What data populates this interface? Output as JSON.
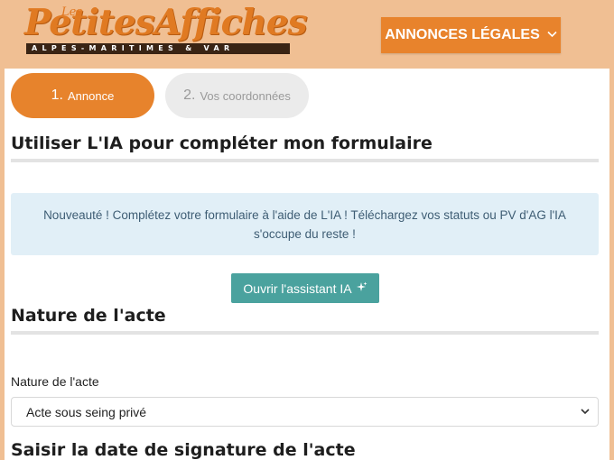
{
  "header": {
    "logo": {
      "les": "Les",
      "brand": "PetitesAffiches",
      "region": "ALPES-MARITIMES & VAR"
    },
    "menu_button": {
      "label": "ANNONCES LÉGALES",
      "icon": "chevron-down-icon"
    }
  },
  "steps": [
    {
      "number": "1.",
      "label": "Annonce",
      "active": true
    },
    {
      "number": "2.",
      "label": "Vos coordonnées",
      "active": false
    }
  ],
  "ai_section": {
    "title": "Utiliser L'IA pour compléter mon formulaire",
    "info_text": "Nouveauté ! Complétez votre formulaire à l'aide de L'IA ! Téléchargez vos statuts ou PV d'AG l'IA s'occupe du reste !",
    "button_label": "Ouvrir l'assistant IA",
    "button_icon": "sparkles-icon"
  },
  "nature_section": {
    "title": "Nature de l'acte",
    "field_label": "Nature de l'acte",
    "selected_value": "Acte sous seing privé"
  },
  "date_section": {
    "title": "Saisir la date de signature de l'acte"
  },
  "colors": {
    "header_bg": "#f0bf93",
    "accent_orange": "#e7832c",
    "teal_button": "#4aa29e",
    "info_bg": "#e1eff7"
  }
}
